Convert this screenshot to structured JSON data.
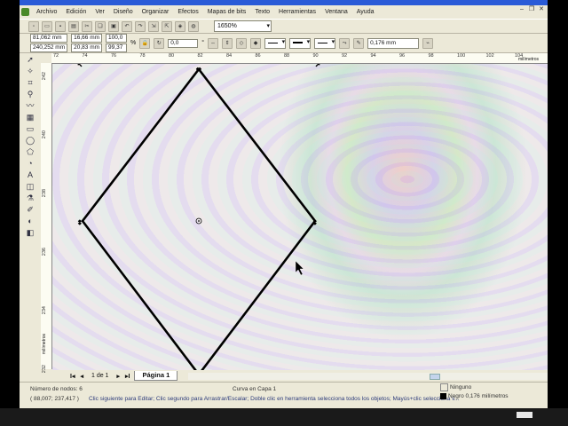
{
  "menu": [
    "Archivo",
    "Edición",
    "Ver",
    "Diseño",
    "Organizar",
    "Efectos",
    "Mapas de bits",
    "Texto",
    "Herramientas",
    "Ventana",
    "Ayuda"
  ],
  "toolbar": {
    "zoom": "1650%"
  },
  "propbar": {
    "x": "81,062 mm",
    "y": "240,252 mm",
    "width": "16,66 mm",
    "height": "20,83 mm",
    "scale_x": "100,0",
    "scale_y": "99,37",
    "scale_unit": "%",
    "rotation": "0,0",
    "rotation_unit": "°",
    "outline_width": "0,176 mm"
  },
  "ruler_h": {
    "labels": [
      "72",
      "74",
      "76",
      "78",
      "80",
      "82",
      "84",
      "86",
      "88",
      "90",
      "92",
      "94",
      "96",
      "98",
      "100",
      "102",
      "104"
    ],
    "unit": "milímetros"
  },
  "ruler_v": {
    "labels": [
      "242",
      "240",
      "238",
      "236",
      "234",
      "232"
    ],
    "unit": "milímetros"
  },
  "page_tabs": {
    "count": "1 de 1",
    "page": "Página 1"
  },
  "status": {
    "node_count": "Número de nodos: 6",
    "layer": "Curva en Capa 1",
    "coords": "( 88,007; 237,417 )",
    "hint": "Clic siguiente para Editar; Clic segundo para Arrastrar/Escalar; Doble clic en herramienta selecciona todos los objetos; Mayús+clic selecciona v...",
    "fill": "Ninguno",
    "outline": "Negro 0,176 milímetros"
  },
  "colors": {
    "outline": "#000000",
    "hint_text": "#2b3a7a",
    "titlebar": "#2a5bd7"
  }
}
